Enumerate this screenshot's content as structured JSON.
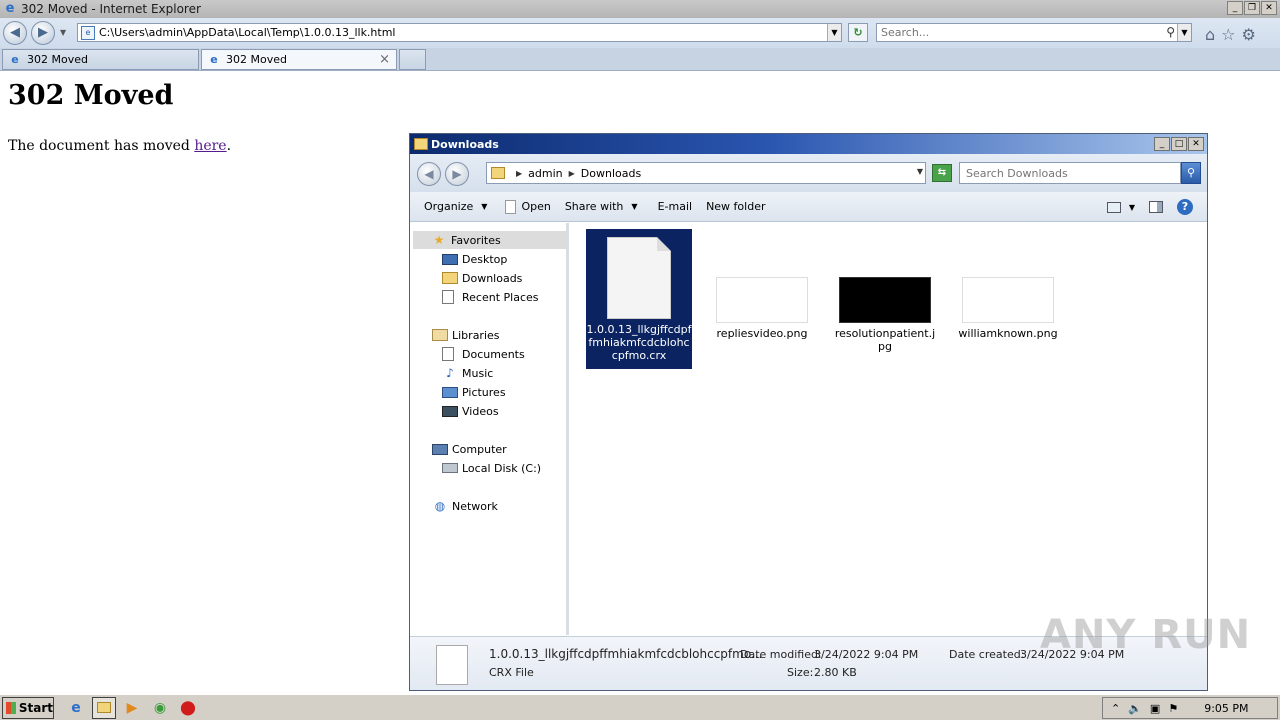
{
  "ie": {
    "window_title": "302 Moved - Internet Explorer",
    "address": "C:\\Users\\admin\\AppData\\Local\\Temp\\1.0.0.13_llk.html",
    "search_placeholder": "Search...",
    "tabs": [
      {
        "label": "302 Moved"
      },
      {
        "label": "302 Moved"
      }
    ],
    "tab_close": "×"
  },
  "page": {
    "heading": "302 Moved",
    "text": "The document has moved ",
    "link": "here",
    "period": "."
  },
  "explorer": {
    "title": "Downloads",
    "breadcrumb": [
      "admin",
      "Downloads"
    ],
    "search_placeholder": "Search Downloads",
    "commands": {
      "organize": "Organize",
      "open": "Open",
      "share_with": "Share with",
      "email": "E-mail",
      "new_folder": "New folder"
    },
    "nav": {
      "favorites": "Favorites",
      "desktop": "Desktop",
      "downloads": "Downloads",
      "recent_places": "Recent Places",
      "libraries": "Libraries",
      "documents": "Documents",
      "music": "Music",
      "pictures": "Pictures",
      "videos": "Videos",
      "computer": "Computer",
      "local_disk": "Local Disk (C:)",
      "network": "Network"
    },
    "files": [
      {
        "name": "1.0.0.13_llkgjffcdpffmhiakmfcdcblohccpfmo.crx",
        "selected": true
      },
      {
        "name": "repliesvideo.png",
        "thumb_color": "#ffffff"
      },
      {
        "name": "resolutionpatient.jpg",
        "thumb_color": "#000000"
      },
      {
        "name": "williamknown.png",
        "thumb_color": "#ffffff"
      }
    ],
    "details": {
      "name": "1.0.0.13_llkgjffcdpffmhiakmfcdcblohccpfmo...",
      "type": "CRX File",
      "date_modified_label": "Date modified:",
      "date_modified": "3/24/2022 9:04 PM",
      "size_label": "Size:",
      "size": "2.80 KB",
      "date_created_label": "Date created:",
      "date_created": "3/24/2022 9:04 PM"
    }
  },
  "watermark": "ANY RUN",
  "taskbar": {
    "start": "Start",
    "clock": "9:05 PM"
  }
}
